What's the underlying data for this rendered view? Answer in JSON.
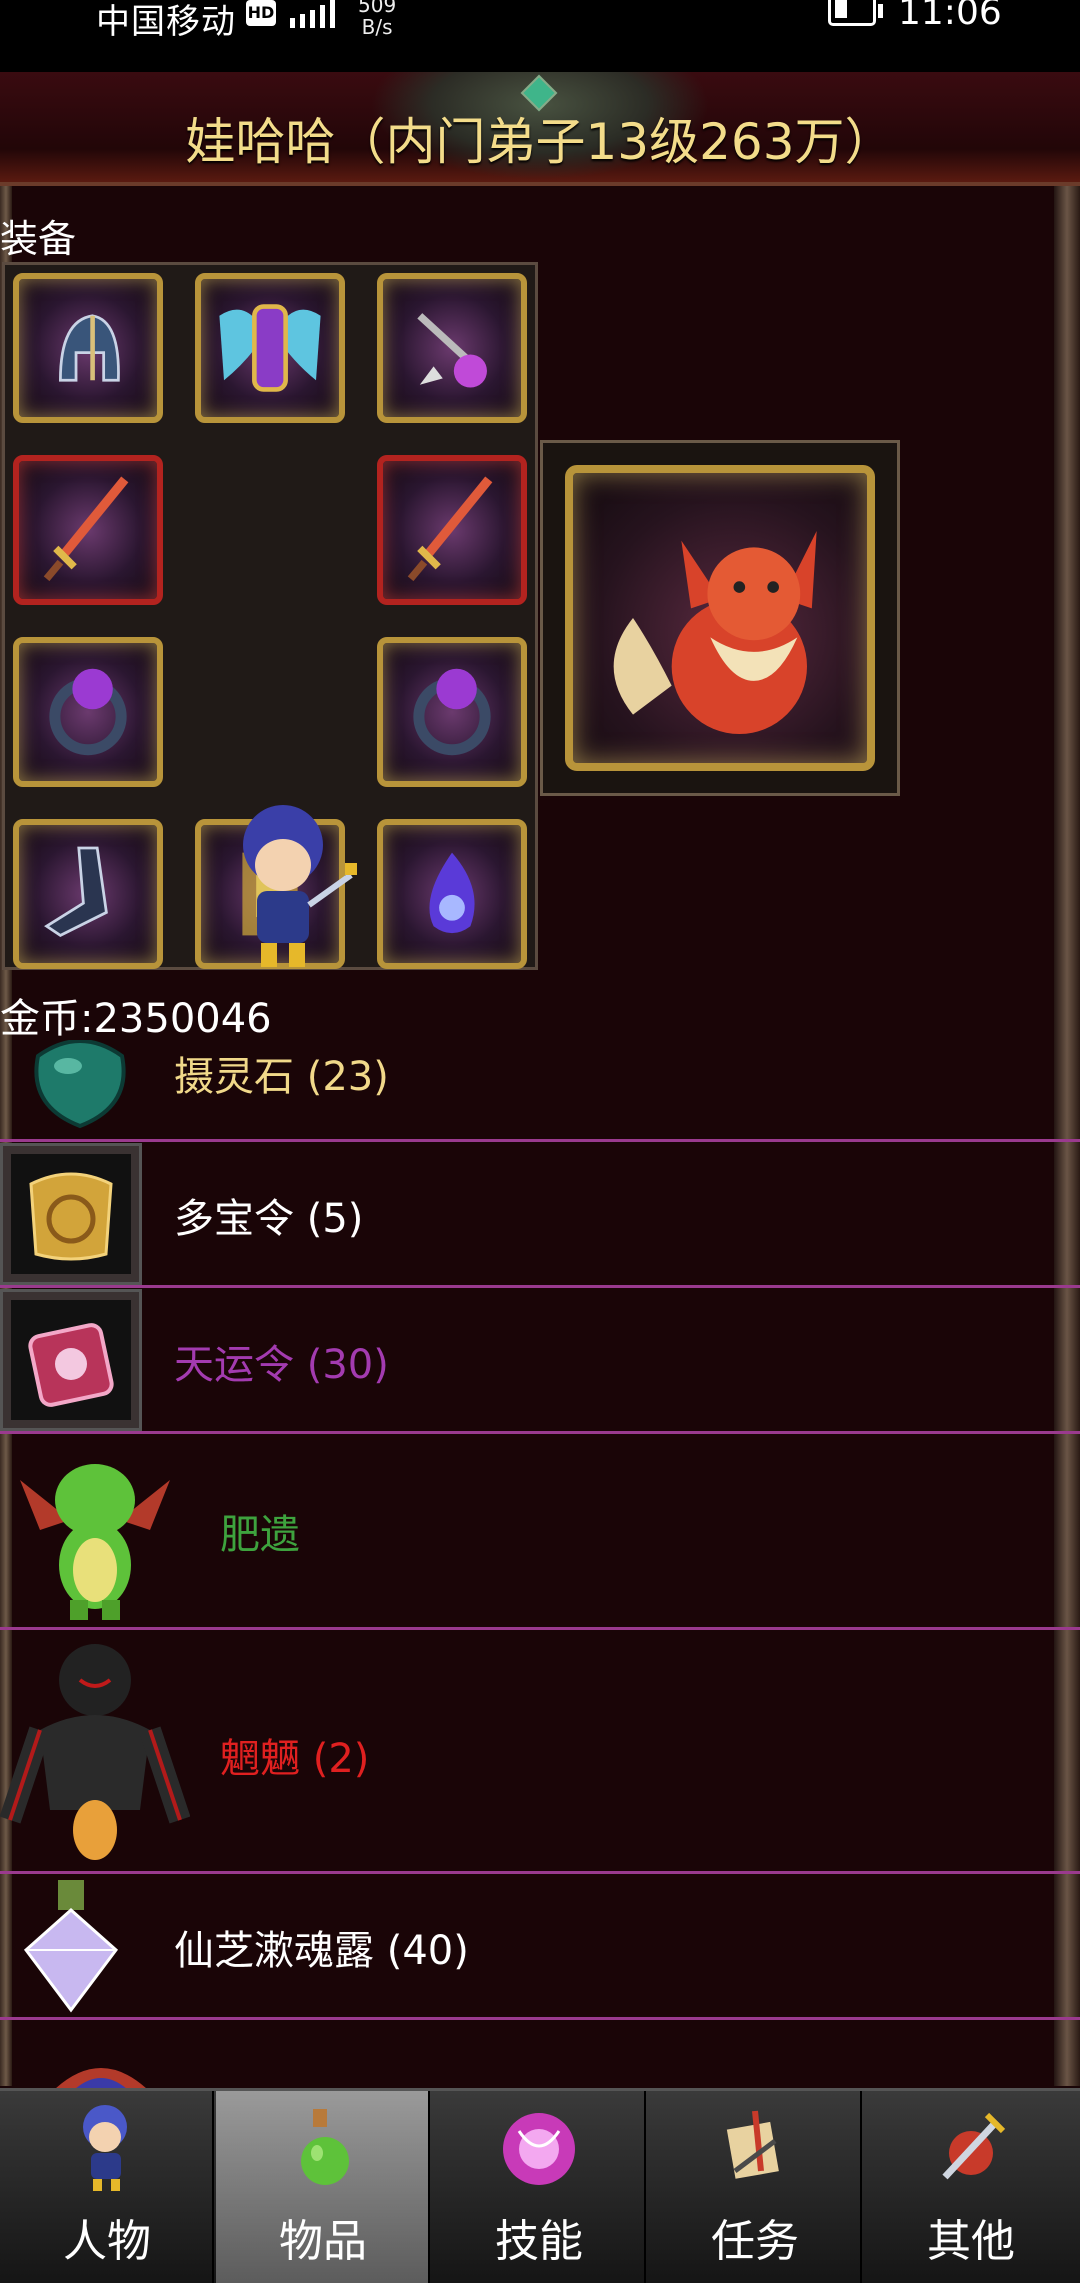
{
  "status_bar": {
    "carrier": "中国移动",
    "hd_badge": "HD",
    "speed": "509\nB/s",
    "time": "11:06"
  },
  "header": {
    "title": "娃哈哈（内门弟子13级263万）"
  },
  "equipment": {
    "label": "装备",
    "slots": [
      "helmet-icon",
      "wing-armor-icon",
      "amulet-icon",
      "sword-icon",
      "sword-icon",
      "ring-icon",
      "ring-icon",
      "boots-icon",
      "belt-icon",
      "flame-gem-icon"
    ],
    "pet": "fox-pet-icon"
  },
  "gold": "金币:2350046",
  "items": [
    {
      "name": "摄灵石 (23)",
      "color": "#f1d98a",
      "icon": "green-stone-icon"
    },
    {
      "name": "多宝令 (5)",
      "color": "#ffffff",
      "icon": "gold-token-icon"
    },
    {
      "name": "天运令 (30)",
      "color": "#a33bb0",
      "icon": "pink-token-icon"
    },
    {
      "name": "肥遗",
      "color": "#3ea33e",
      "icon": "green-dragon-icon"
    },
    {
      "name": "魍魉 (2)",
      "color": "#e02020",
      "icon": "dark-demon-icon"
    },
    {
      "name": "仙芝漱魂露 (40)",
      "color": "#ffffff",
      "icon": "crystal-flask-icon"
    }
  ],
  "tabs": [
    {
      "label": "人物",
      "icon": "character-icon",
      "active": false
    },
    {
      "label": "物品",
      "icon": "potion-icon",
      "active": true
    },
    {
      "label": "技能",
      "icon": "magic-orb-icon",
      "active": false
    },
    {
      "label": "任务",
      "icon": "quest-scroll-icon",
      "active": false
    },
    {
      "label": "其他",
      "icon": "sword-emblem-icon",
      "active": false
    }
  ]
}
